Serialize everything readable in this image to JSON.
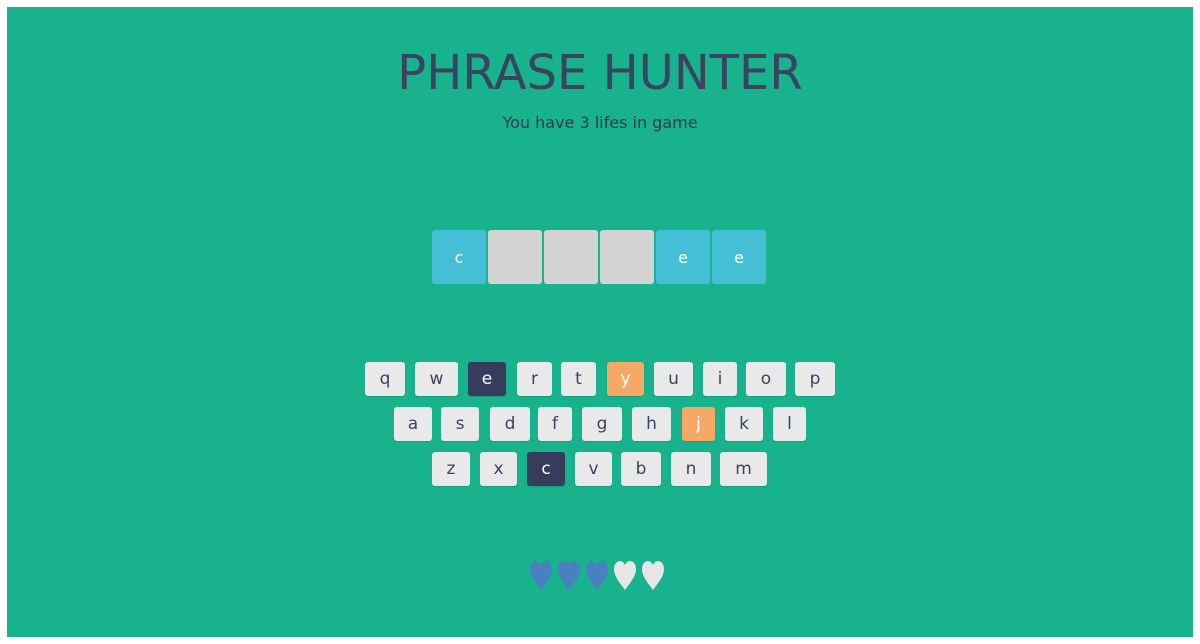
{
  "header": {
    "title": "PHRASE HUNTER",
    "subtitle": "You have 3 lifes in game"
  },
  "phrase": [
    {
      "letter": "c",
      "revealed": true
    },
    {
      "letter": "",
      "revealed": false
    },
    {
      "letter": "",
      "revealed": false
    },
    {
      "letter": "",
      "revealed": false
    },
    {
      "letter": "e",
      "revealed": true
    },
    {
      "letter": "e",
      "revealed": true
    }
  ],
  "keyboard": {
    "rows": [
      [
        "q",
        "w",
        "e",
        "r",
        "t",
        "y",
        "u",
        "i",
        "o",
        "p"
      ],
      [
        "a",
        "s",
        "d",
        "f",
        "g",
        "h",
        "j",
        "k",
        "l"
      ],
      [
        "z",
        "x",
        "c",
        "v",
        "b",
        "n",
        "m"
      ]
    ],
    "correct_keys": [
      "e",
      "c"
    ],
    "wrong_keys": [
      "y",
      "j"
    ]
  },
  "lives": {
    "total": 5,
    "remaining": 3,
    "live_heart_icon": "live-heart-icon",
    "lost_heart_icon": "lost-heart-icon"
  },
  "colors": {
    "background": "#18b38d",
    "title": "#3a4360",
    "revealed_tile": "#45bfd5",
    "hidden_tile": "#d3d3d3",
    "key_default": "#e9e9e9",
    "key_correct": "#363d5c",
    "key_wrong": "#f6a964",
    "heart_live": "#4a7fc0",
    "heart_lost": "#e6e6e6"
  }
}
